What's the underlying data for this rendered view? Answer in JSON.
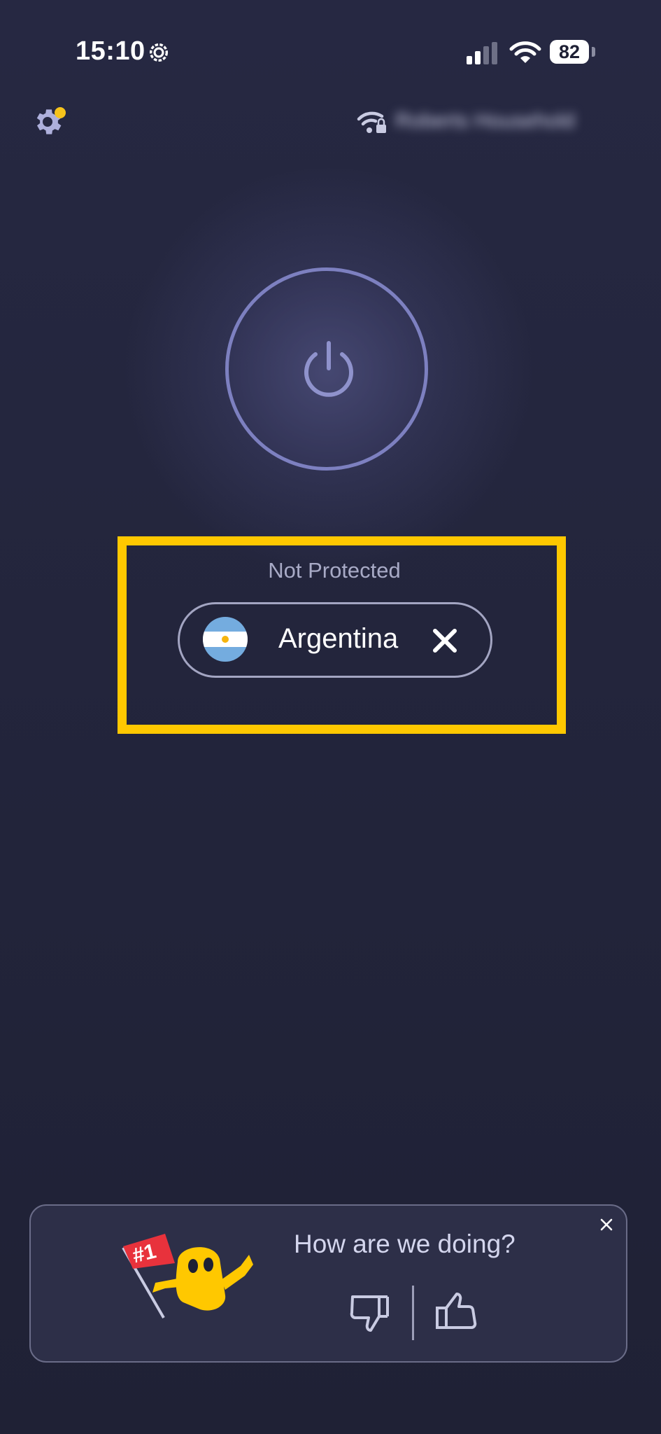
{
  "status_bar": {
    "time": "15:10",
    "battery": "82",
    "icons": [
      "gear-status-icon",
      "cellular-signal-icon",
      "wifi-icon",
      "battery-icon"
    ]
  },
  "header": {
    "settings_icon": "gear-icon",
    "notification_dot_color": "#f6c31b",
    "network_icon": "secure-wifi-icon",
    "network_name": "Roberts Household"
  },
  "connection": {
    "power_icon": "power-icon",
    "status": "Not Protected",
    "location": {
      "country": "Argentina",
      "flag_icon": "argentina-flag-icon",
      "clear_icon": "close-icon"
    }
  },
  "highlight_color": "#ffc800",
  "feedback": {
    "question": "How are we doing?",
    "mascot_badge": "#1",
    "close_icon": "close-icon",
    "thumbs_down_icon": "thumbs-down-icon",
    "thumbs_up_icon": "thumbs-up-icon"
  }
}
